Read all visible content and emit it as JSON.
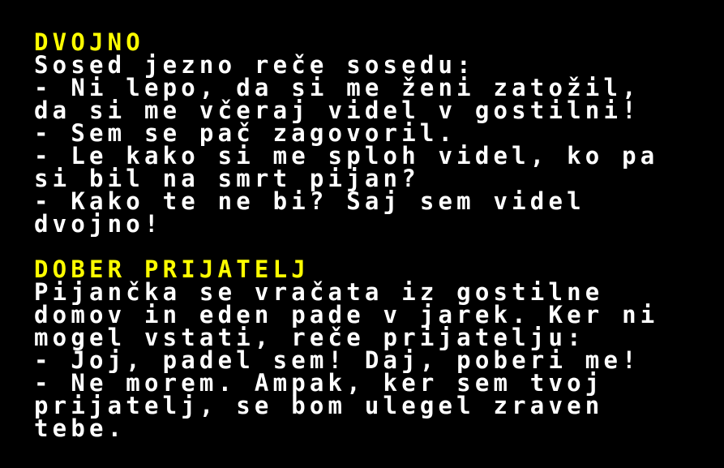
{
  "colors": {
    "background": "#000000",
    "title": "#ffff00",
    "text": "#ffffff"
  },
  "joke1": {
    "title": "DVOJNO",
    "lines": [
      "Sosed jezno reče sosedu:",
      "- Ni lepo, da si me ženi zatožil,",
      "da si me včeraj videl v gostilni!",
      "- Sem se pač zagovoril.",
      "- Le kako si me sploh videl, ko pa",
      "si bil na smrt pijan?",
      "- Kako te ne bi? Saj sem videl",
      "dvojno!"
    ]
  },
  "joke2": {
    "title": "DOBER PRIJATELJ",
    "lines": [
      "Pijančka se vračata iz gostilne",
      "domov in eden pade v jarek. Ker ni",
      "mogel vstati, reče prijatelju:",
      "- Joj, padel sem! Daj, poberi me!",
      "- Ne morem. Ampak, ker sem tvoj",
      "prijatelj, se bom ulegel zraven",
      "tebe."
    ]
  }
}
